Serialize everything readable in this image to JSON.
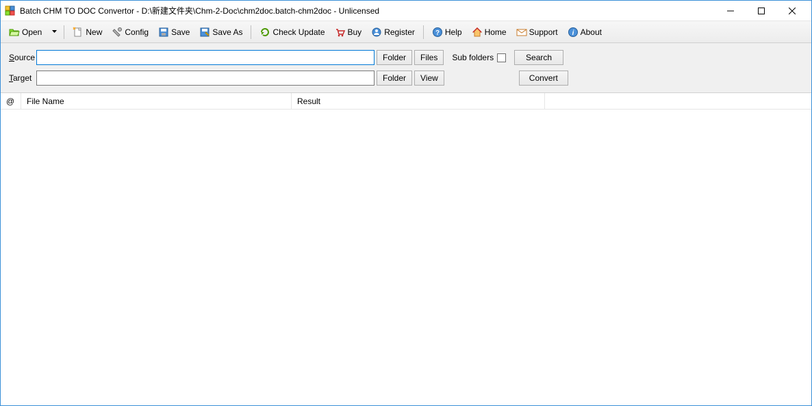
{
  "window": {
    "title": "Batch CHM TO DOC Convertor - D:\\新建文件夹\\Chm-2-Doc\\chm2doc.batch-chm2doc - Unlicensed"
  },
  "toolbar": {
    "open": "Open",
    "new": "New",
    "config": "Config",
    "save": "Save",
    "save_as": "Save As",
    "check_update": "Check Update",
    "buy": "Buy",
    "register": "Register",
    "help": "Help",
    "home": "Home",
    "support": "Support",
    "about": "About"
  },
  "form": {
    "source_label_prefix": "S",
    "source_label_rest": "ource",
    "source_value": "",
    "target_label_prefix": "T",
    "target_label_rest": "arget",
    "target_value": "",
    "folder_btn": "Folder",
    "files_btn": "Files",
    "view_btn": "View",
    "sub_folders": "Sub folders",
    "search_btn": "Search",
    "convert_btn": "Convert"
  },
  "list": {
    "col_at": "@",
    "col_file": "File Name",
    "col_result": "Result"
  }
}
